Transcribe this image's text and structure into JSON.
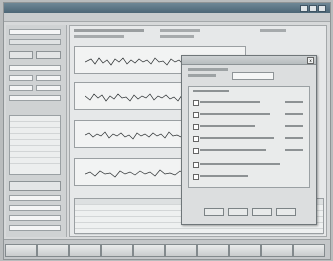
{
  "window": {
    "title": ""
  },
  "menu": {
    "items": [
      "",
      "",
      "",
      "",
      ""
    ]
  },
  "sidebar": {
    "labels": [],
    "fields": []
  },
  "main": {
    "plots": [
      {
        "label": ""
      },
      {
        "label": ""
      },
      {
        "label": ""
      },
      {
        "label": ""
      }
    ]
  },
  "dialog": {
    "title": "",
    "close_label": "x",
    "options_count_visible": 7
  },
  "bottom_bar": {
    "keys": [
      "",
      "",
      "",
      "",
      "",
      "",
      "",
      "",
      "",
      ""
    ]
  }
}
